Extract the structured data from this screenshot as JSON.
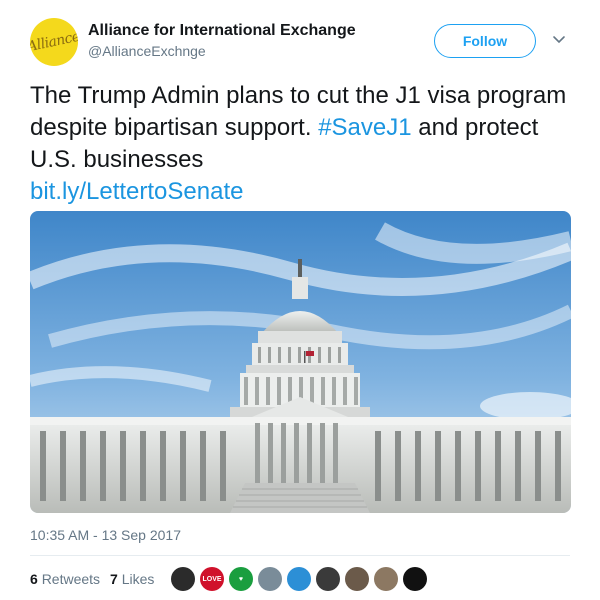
{
  "account": {
    "display_name": "Alliance for International Exchange",
    "handle": "@AllianceExchnge",
    "avatar_text": "Alliance",
    "avatar_color": "#f4d91c"
  },
  "follow_button": {
    "label": "Follow"
  },
  "tweet": {
    "text_part1": "The Trump Admin plans to cut the J1 visa program despite bipartisan support. ",
    "hashtag": "#SaveJ1",
    "text_part2": " and protect U.S. businesses",
    "link": "bit.ly/LettertoSenate"
  },
  "photo": {
    "subject": "United States Capitol building"
  },
  "meta": {
    "timestamp": "10:35 AM - 13 Sep 2017",
    "retweets_count": "6",
    "retweets_label": "Retweets",
    "likes_count": "7",
    "likes_label": "Likes"
  },
  "likers": [
    {
      "name": "liker-avatar-1",
      "color": "#2b2b2b",
      "text": ""
    },
    {
      "name": "liker-avatar-2",
      "color": "#d0112b",
      "text": "LOVE"
    },
    {
      "name": "liker-avatar-3",
      "color": "#1a9e3f",
      "text": "♥"
    },
    {
      "name": "liker-avatar-4",
      "color": "#7a8c99",
      "text": ""
    },
    {
      "name": "liker-avatar-5",
      "color": "#2c8fd6",
      "text": ""
    },
    {
      "name": "liker-avatar-6",
      "color": "#3a3a3a",
      "text": ""
    },
    {
      "name": "liker-avatar-7",
      "color": "#6b5a4a",
      "text": ""
    },
    {
      "name": "liker-avatar-8",
      "color": "#8c7862",
      "text": ""
    },
    {
      "name": "liker-avatar-9",
      "color": "#111111",
      "text": ""
    }
  ],
  "colors": {
    "link_blue": "#1b95e0",
    "follow_blue": "#1da1f2",
    "muted": "#657786"
  }
}
